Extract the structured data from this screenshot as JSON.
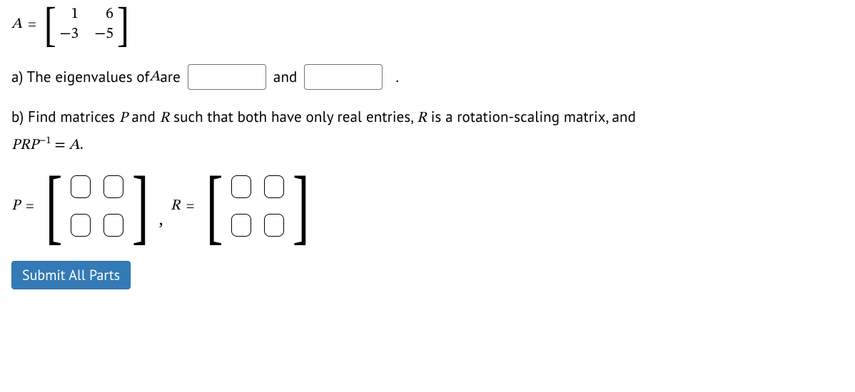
{
  "matrixA": {
    "var": "A",
    "equals": "=",
    "lbr": "[",
    "rbr": "]",
    "a11": "1",
    "a12": "6",
    "a21": "−3",
    "a22": "−5"
  },
  "partA": {
    "prefix": "a) The eigenvalues of ",
    "var": "A",
    "mid1": " are",
    "and": "and",
    "period": "."
  },
  "partB": {
    "line1a": "b) Find matrices ",
    "P": "P",
    "line1b": " and ",
    "R": "R",
    "line1c": " such that both have only real entries, ",
    "R2": "R",
    "line1d": " is a rotation-scaling matrix, and",
    "line2a": "PRP",
    "exp": "−1",
    "line2b": " = ",
    "A": "A",
    "line2c": "."
  },
  "PR": {
    "Pvar": "P",
    "eq1": "=",
    "lbr": "[",
    "rbr": "]",
    "comma": ",",
    "Rvar": "R",
    "eq2": "="
  },
  "submit": {
    "label": "Submit All Parts"
  }
}
